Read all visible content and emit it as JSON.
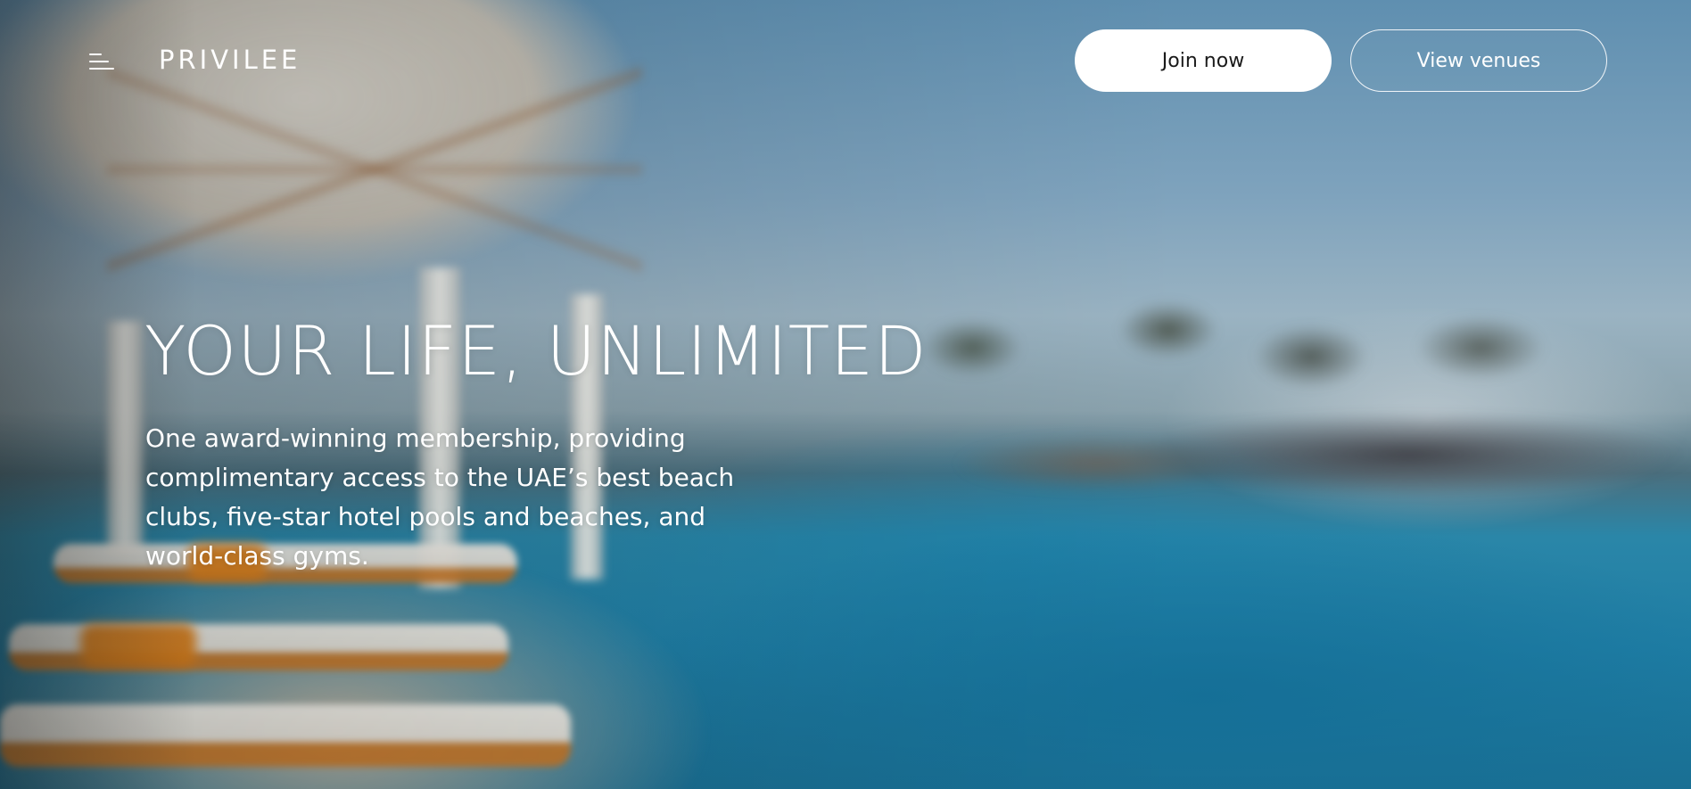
{
  "header": {
    "menu_icon": "hamburger-menu-icon",
    "logo_text": "PRIVILEE",
    "join_button_label": "Join now",
    "venues_button_label": "View venues"
  },
  "hero": {
    "title": "YOUR LIFE, UNLIMITED",
    "description": "One award-winning membership, providing complimentary access to the UAE’s best beach clubs, five-star hotel pools and beaches, and world-class gyms."
  },
  "colors": {
    "text": "#ffffff",
    "primary_button_bg": "#ffffff",
    "primary_button_text": "#1a1a1a",
    "secondary_button_border": "#ffffff"
  }
}
